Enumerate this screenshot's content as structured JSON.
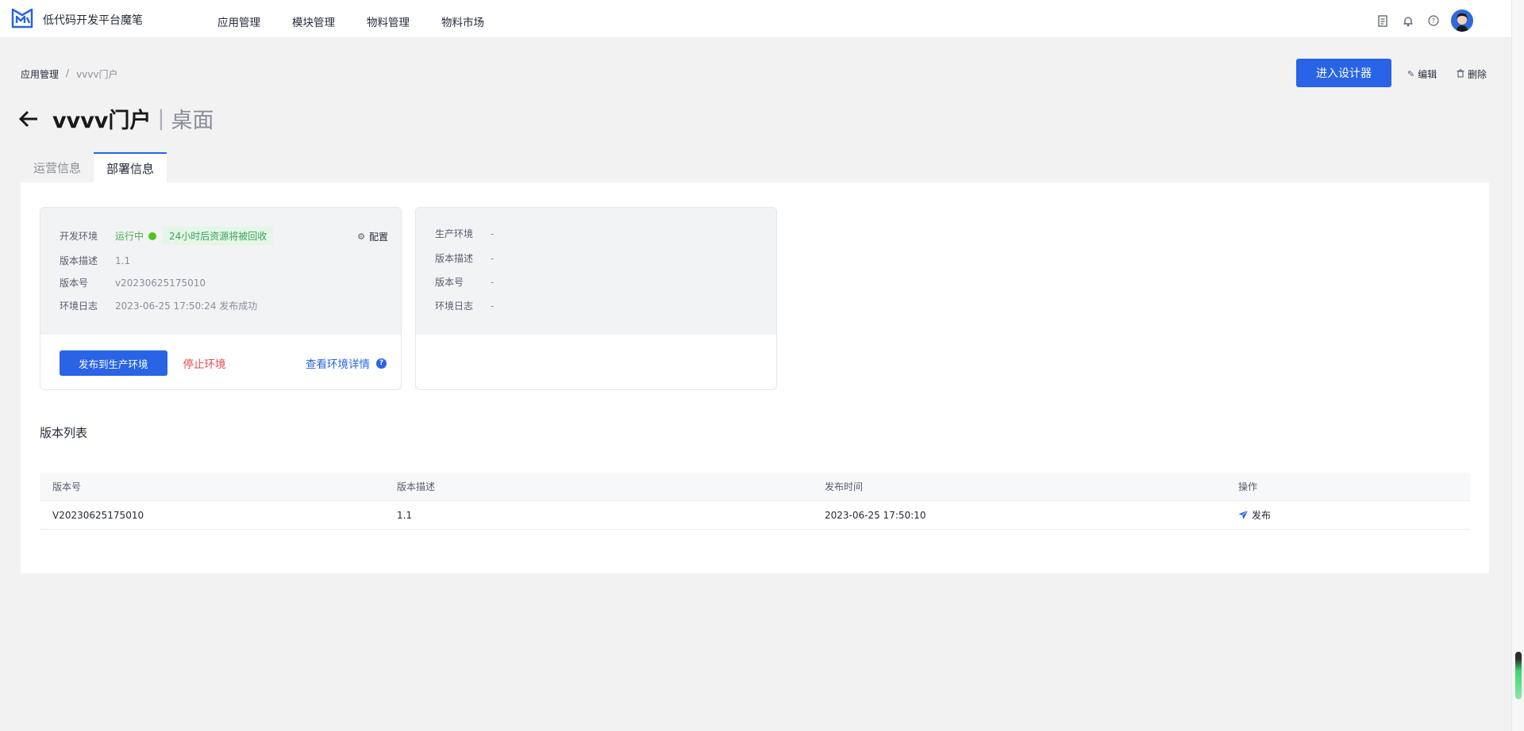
{
  "header": {
    "app_title": "低代码开发平台魔笔",
    "nav": [
      "应用管理",
      "模块管理",
      "物料管理",
      "物料市场"
    ],
    "icons": [
      "document-icon",
      "bell-icon",
      "help-icon",
      "avatar"
    ]
  },
  "breadcrumb": {
    "parent": "应用管理",
    "separator": "/",
    "current": "vvvv门户"
  },
  "actions": {
    "enter_designer": "进入设计器",
    "edit": "编辑",
    "delete": "删除"
  },
  "title": {
    "main": "vvvv门户",
    "separator": "|",
    "sub": "桌面"
  },
  "tabs": [
    {
      "label": "运营信息",
      "active": false
    },
    {
      "label": "部署信息",
      "active": true
    }
  ],
  "dev_env": {
    "env_label": "开发环境",
    "status": "运行中",
    "status_tag": "24小时后资源将被回收",
    "config": "配置",
    "desc_label": "版本描述",
    "desc_value": "1.1",
    "version_label": "版本号",
    "version_value": "v20230625175010",
    "log_label": "环境日志",
    "log_value": "2023-06-25 17:50:24 发布成功",
    "publish_button": "发布到生产环境",
    "stop_button": "停止环境",
    "detail_link": "查看环境详情"
  },
  "prod_env": {
    "env_label": "生产环境",
    "env_value": "-",
    "desc_label": "版本描述",
    "desc_value": "-",
    "version_label": "版本号",
    "version_value": "-",
    "log_label": "环境日志",
    "log_value": "-"
  },
  "version_list": {
    "title": "版本列表",
    "columns": [
      "版本号",
      "版本描述",
      "发布时间",
      "操作"
    ],
    "rows": [
      {
        "version": "V20230625175010",
        "desc": "1.1",
        "time": "2023-06-25 17:50:10",
        "action": "发布"
      }
    ]
  },
  "colors": {
    "primary": "#2964e6",
    "danger": "#e84b4b",
    "success": "#52c41a"
  }
}
